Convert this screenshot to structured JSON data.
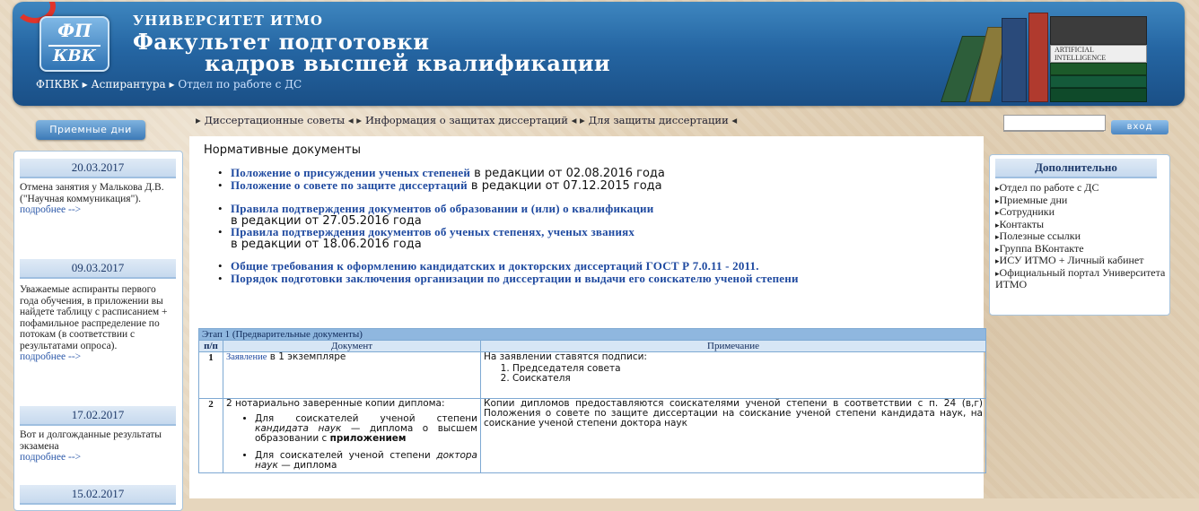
{
  "header": {
    "logo_top": "ФП",
    "logo_bottom": "КВК",
    "university": "УНИВЕРСИТЕТ ИТМО",
    "faculty_line1": "Факультет подготовки",
    "faculty_line2": "кадров высшей квалификации",
    "books_label": "ARTIFICIAL INTELLIGENCE"
  },
  "breadcrumb": {
    "item1": "ФПКВК",
    "item2": "Аспирантура",
    "current": "Отдел по работе с ДС",
    "sep": "▸"
  },
  "left": {
    "priem_button": "Приемные дни",
    "news": [
      {
        "date": "20.03.2017",
        "text": "Отмена занятия у Малькова Д.В. (\"Научная коммуникация\").",
        "more": "подробнее -->"
      },
      {
        "date": "09.03.2017",
        "text": "Уважаемые аспиранты первого года обучения, в приложении вы найдете таблицу с расписанием + пофамильное распределение по потокам (в соответствии с результатами опроса).",
        "more": "подробнее -->"
      },
      {
        "date": "17.02.2017",
        "text": "Вот и долгожданные результаты экзамена",
        "more": "подробнее -->"
      },
      {
        "date": "15.02.2017",
        "text": "",
        "more": ""
      }
    ]
  },
  "tabs": {
    "t1": "Диссертационные советы",
    "t2": "Информация о защитах диссертаций",
    "t3": "Для защиты диссертации"
  },
  "content": {
    "title": "Нормативные документы",
    "docs": [
      {
        "link": "Положение о присуждении ученых степеней",
        "rest": " в редакции от 02.08.2016 года"
      },
      {
        "link": "Положение о совете по защите диссертаций",
        "rest": " в редакции от 07.12.2015 года"
      },
      {
        "link": "Правила подтверждения документов об образовании и (или) о квалификации",
        "rest": "в редакции от 27.05.2016 года"
      },
      {
        "link": "Правила подтверждения документов об ученых степенях, ученых званиях",
        "rest": "в редакции от 18.06.2016 года"
      },
      {
        "link": "Общие требования к оформлению кандидатских и докторских диссертаций ГОСТ Р 7.0.11 - 2011."
      },
      {
        "link": "Порядок подготовки заключения организации по диссертации и выдачи его соискателю ученой степени"
      }
    ],
    "stage_title": "Этап 1 (Предварительные документы)",
    "col_num": "п/п",
    "col_doc": "Документ",
    "col_note": "Примечание",
    "row1": {
      "num": "1",
      "doc_link": "Заявление",
      "doc_rest": " в 1 экземпляре",
      "note_head": "На заявлении ставятся подписи:",
      "note_items": [
        "Председателя совета",
        "Соискателя"
      ]
    },
    "row2": {
      "num": "2",
      "doc_intro": "2 нотариально заверенные копии диплома:",
      "item1_a": "Для соискателей ученой степени ",
      "item1_b": "кандидата наук",
      "item1_c": " — диплома о высшем образовании с ",
      "item1_d": "приложением",
      "item2_a": "Для соискателей ученой степени ",
      "item2_b": "доктора наук",
      "item2_c": " — диплома",
      "note": "Копии дипломов предоставляются соискателями ученой степени в соответствии с п. 24 (в,г) Положения о совете по защите диссертации на соискание ученой степени кандидата наук, на соискание ученой степени доктора наук"
    }
  },
  "right": {
    "login_button": "вход",
    "extra_title": "Дополнительно",
    "extra_items": [
      "Отдел по работе с ДС",
      "Приемные дни",
      "Сотрудники",
      "Контакты",
      "Полезные ссылки",
      "Группа ВКонтакте",
      "ИСУ ИТМО + Личный кабинет",
      "Официальный портал Университета ИТМО"
    ]
  },
  "colors": {
    "header": "#2566a3",
    "link": "#1f4aa0",
    "table_border": "#7ea9d3",
    "accent_red": "#e0342a"
  }
}
